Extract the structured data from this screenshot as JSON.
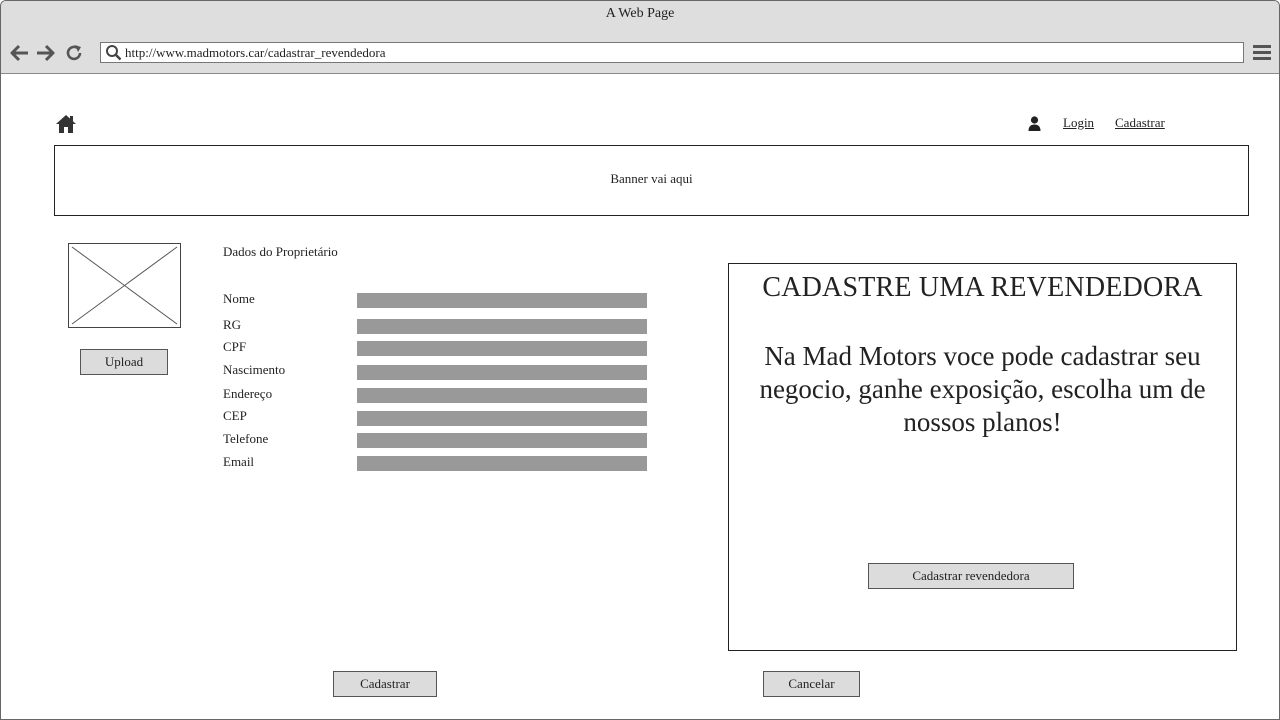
{
  "window": {
    "title": "A Web Page"
  },
  "browser": {
    "url": "http://www.madmotors.car/cadastrar_revendedora",
    "icons": {
      "back": "arrow-left-icon",
      "forward": "arrow-right-icon",
      "reload": "reload-icon",
      "search": "search-icon",
      "menu": "hamburger-menu-icon"
    }
  },
  "header": {
    "home_icon": "home-icon",
    "user_icon": "user-icon",
    "login_label": "Login",
    "register_label": "Cadastrar"
  },
  "banner": {
    "text": "Banner vai aqui"
  },
  "profile": {
    "photo_placeholder": "image-placeholder",
    "upload_label": "Upload"
  },
  "owner_form": {
    "title": "Dados do Proprietário",
    "fields": [
      {
        "label": "Nome",
        "value": ""
      },
      {
        "label": "RG",
        "value": ""
      },
      {
        "label": "CPF",
        "value": ""
      },
      {
        "label": "Nascimento",
        "value": ""
      },
      {
        "label": "Endereço",
        "value": ""
      },
      {
        "label": "CEP",
        "value": ""
      },
      {
        "label": "Telefone",
        "value": ""
      },
      {
        "label": "Email",
        "value": ""
      }
    ]
  },
  "promo": {
    "title": "CADASTRE UMA REVENDEDORA",
    "text": "Na Mad Motors voce pode cadastrar seu negocio, ganhe exposição, escolha um de nossos planos!",
    "button_label": "Cadastrar revendedora"
  },
  "footer_actions": {
    "submit_label": "Cadastrar",
    "cancel_label": "Cancelar"
  }
}
